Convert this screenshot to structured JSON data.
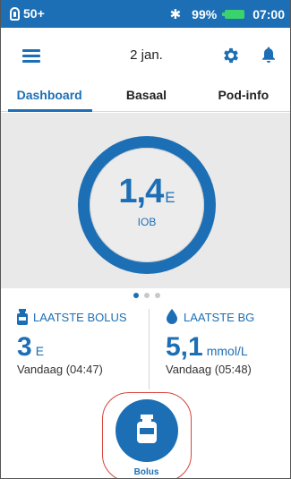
{
  "statusbar": {
    "pod_reservoir": "50+",
    "battery_pct": "99%",
    "time": "07:00",
    "battery_color": "#3ad36b"
  },
  "header": {
    "date": "2 jan."
  },
  "tabs": [
    {
      "label": "Dashboard",
      "active": true
    },
    {
      "label": "Basaal",
      "active": false
    },
    {
      "label": "Pod-info",
      "active": false
    }
  ],
  "dashboard": {
    "iob_value": "1,4",
    "iob_unit": "E",
    "iob_label": "IOB",
    "page_dots": 3,
    "active_dot": 1
  },
  "last_bolus": {
    "title": "LAATSTE BOLUS",
    "value": "3",
    "unit": "E",
    "when": "Vandaag (04:47)"
  },
  "last_bg": {
    "title": "LAATSTE BG",
    "value": "5,1",
    "unit": "mmol/L",
    "when": "Vandaag (05:48)"
  },
  "bolus_button": {
    "label": "Bolus"
  },
  "colors": {
    "accent": "#1c6fb5",
    "highlight_outline": "#d9443b",
    "panel_bg": "#e9e9e9"
  }
}
